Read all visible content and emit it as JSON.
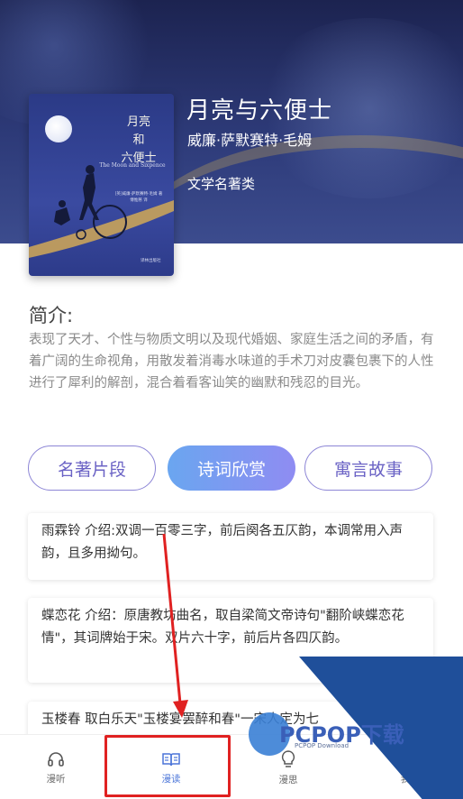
{
  "book": {
    "title": "月亮与六便士",
    "author": "威廉·萨默赛特·毛姆",
    "category": "文学名著类",
    "cover": {
      "title_line1": "月亮",
      "title_line2": "和",
      "title_line3": "六便士",
      "subtitle": "The Moon and Sixpence",
      "author_text": "[英]威廉·萨默赛特·毛姆 著",
      "translator_text": "傅惟慈 译",
      "publisher": "译林出版社"
    }
  },
  "intro": {
    "heading": "简介:",
    "text": "表现了天才、个性与物质文明以及现代婚姻、家庭生活之间的矛盾，有着广阔的生命视角，用散发着消毒水味道的手术刀对皮囊包裹下的人性进行了犀利的解剖，混合着看客讪笑的幽默和残忍的目光。"
  },
  "tabs": [
    {
      "label": "名著片段",
      "active": false
    },
    {
      "label": "诗词欣赏",
      "active": true
    },
    {
      "label": "寓言故事",
      "active": false
    }
  ],
  "cards": [
    {
      "text": "雨霖铃 介绍:双调一百零三字，前后阕各五仄韵，本调常用入声韵，且多用拗句。"
    },
    {
      "text": "蝶恋花 介绍：原唐教坊曲名，取自梁简文帝诗句\"翻阶峡蝶恋花情\"，其词牌始于宋。双片六十字，前后片各四仄韵。"
    },
    {
      "text": "玉楼春 取白乐天\"玉楼宴罢醉和春\"一宋人定为七"
    }
  ],
  "watermark": {
    "brand": "PCPOP下载",
    "sub": "PCPOP Download"
  },
  "nav": [
    {
      "label": "漫听",
      "icon": "headphones-icon",
      "active": false
    },
    {
      "label": "漫读",
      "icon": "book-open-icon",
      "active": true
    },
    {
      "label": "漫思",
      "icon": "lightbulb-icon",
      "active": false
    },
    {
      "label": "我",
      "icon": "user-icon",
      "active": false
    }
  ],
  "colors": {
    "accent": "#6b63c5",
    "nav_active": "#4a74d8",
    "highlight": "#e02121",
    "hero": "#2d3a78"
  }
}
